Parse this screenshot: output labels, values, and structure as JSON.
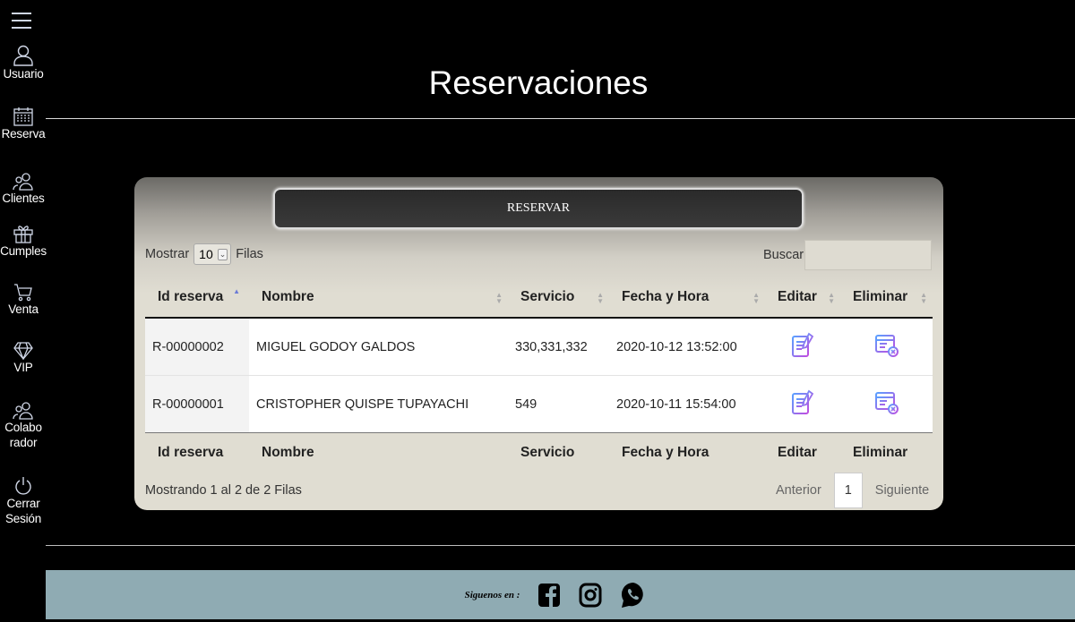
{
  "sidebar": {
    "items": [
      {
        "label": "Usuario",
        "icon": "user-icon"
      },
      {
        "label": "Reserva",
        "icon": "calendar-icon"
      },
      {
        "label": "Clientes",
        "icon": "users-icon"
      },
      {
        "label": "Cumples",
        "icon": "gift-icon"
      },
      {
        "label": "Venta",
        "icon": "cart-icon"
      },
      {
        "label": "VIP",
        "icon": "diamond-icon"
      },
      {
        "label": "Colabo\nrador",
        "icon": "collaborator-icon"
      },
      {
        "label": "Cerrar\nSesión",
        "icon": "power-icon"
      }
    ]
  },
  "page": {
    "title": "Reservaciones"
  },
  "panel": {
    "reserve_button": "RESERVAR",
    "show_prefix": "Mostrar",
    "show_value": "10",
    "show_suffix": "Filas",
    "search_label": "Buscar:",
    "search_value": "",
    "columns": [
      "Id reserva",
      "Nombre",
      "Servicio",
      "Fecha y Hora",
      "Editar",
      "Eliminar"
    ],
    "rows": [
      {
        "id": "R-00000002",
        "nombre": "MIGUEL GODOY GALDOS",
        "servicio": "330,331,332",
        "fecha": "2020-10-12 13:52:00"
      },
      {
        "id": "R-00000001",
        "nombre": "CRISTOPHER QUISPE TUPAYACHI",
        "servicio": "549",
        "fecha": "2020-10-11 15:54:00"
      }
    ],
    "info": "Mostrando 1 al 2 de 2 Filas",
    "pager": {
      "prev": "Anterior",
      "page": "1",
      "next": "Siguiente"
    }
  },
  "footer": {
    "follow_text": "Siguenos en :",
    "icons": [
      "facebook-icon",
      "instagram-icon",
      "whatsapp-icon"
    ]
  },
  "colors": {
    "background": "#000000",
    "footer": "#8fabb3",
    "panel": "#e0ddd2",
    "accent_icon": "#7b6fe0"
  }
}
